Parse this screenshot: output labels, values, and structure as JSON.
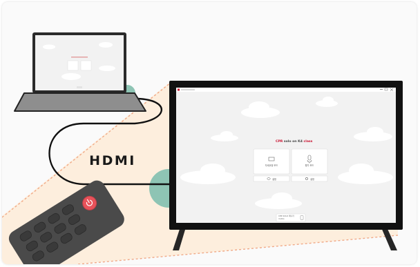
{
  "diagram": {
    "cable_label": "HDMI"
  },
  "tv_screen": {
    "window_title": "",
    "heading": {
      "part1": "CPR",
      "part2": "solo on",
      "part3": "K4",
      "part4": "class"
    },
    "modes": [
      {
        "label": "자세교정 모드",
        "icon": "mannequin-icon"
      },
      {
        "label": "평가 모드",
        "icon": "mic-icon"
      }
    ],
    "mode_buttons": [
      {
        "label": "설정",
        "icon": "eye-icon"
      },
      {
        "label": "설정",
        "icon": "gear-icon"
      }
    ],
    "connection": {
      "line1": "CPR SOLO 매니저",
      "line2": "mobile"
    }
  },
  "colors": {
    "accent": "#c8102e",
    "beige": "#fdeedd",
    "teal": "#8ec4b4",
    "remote": "#4a4a4a",
    "power_button": "#e8525a"
  }
}
